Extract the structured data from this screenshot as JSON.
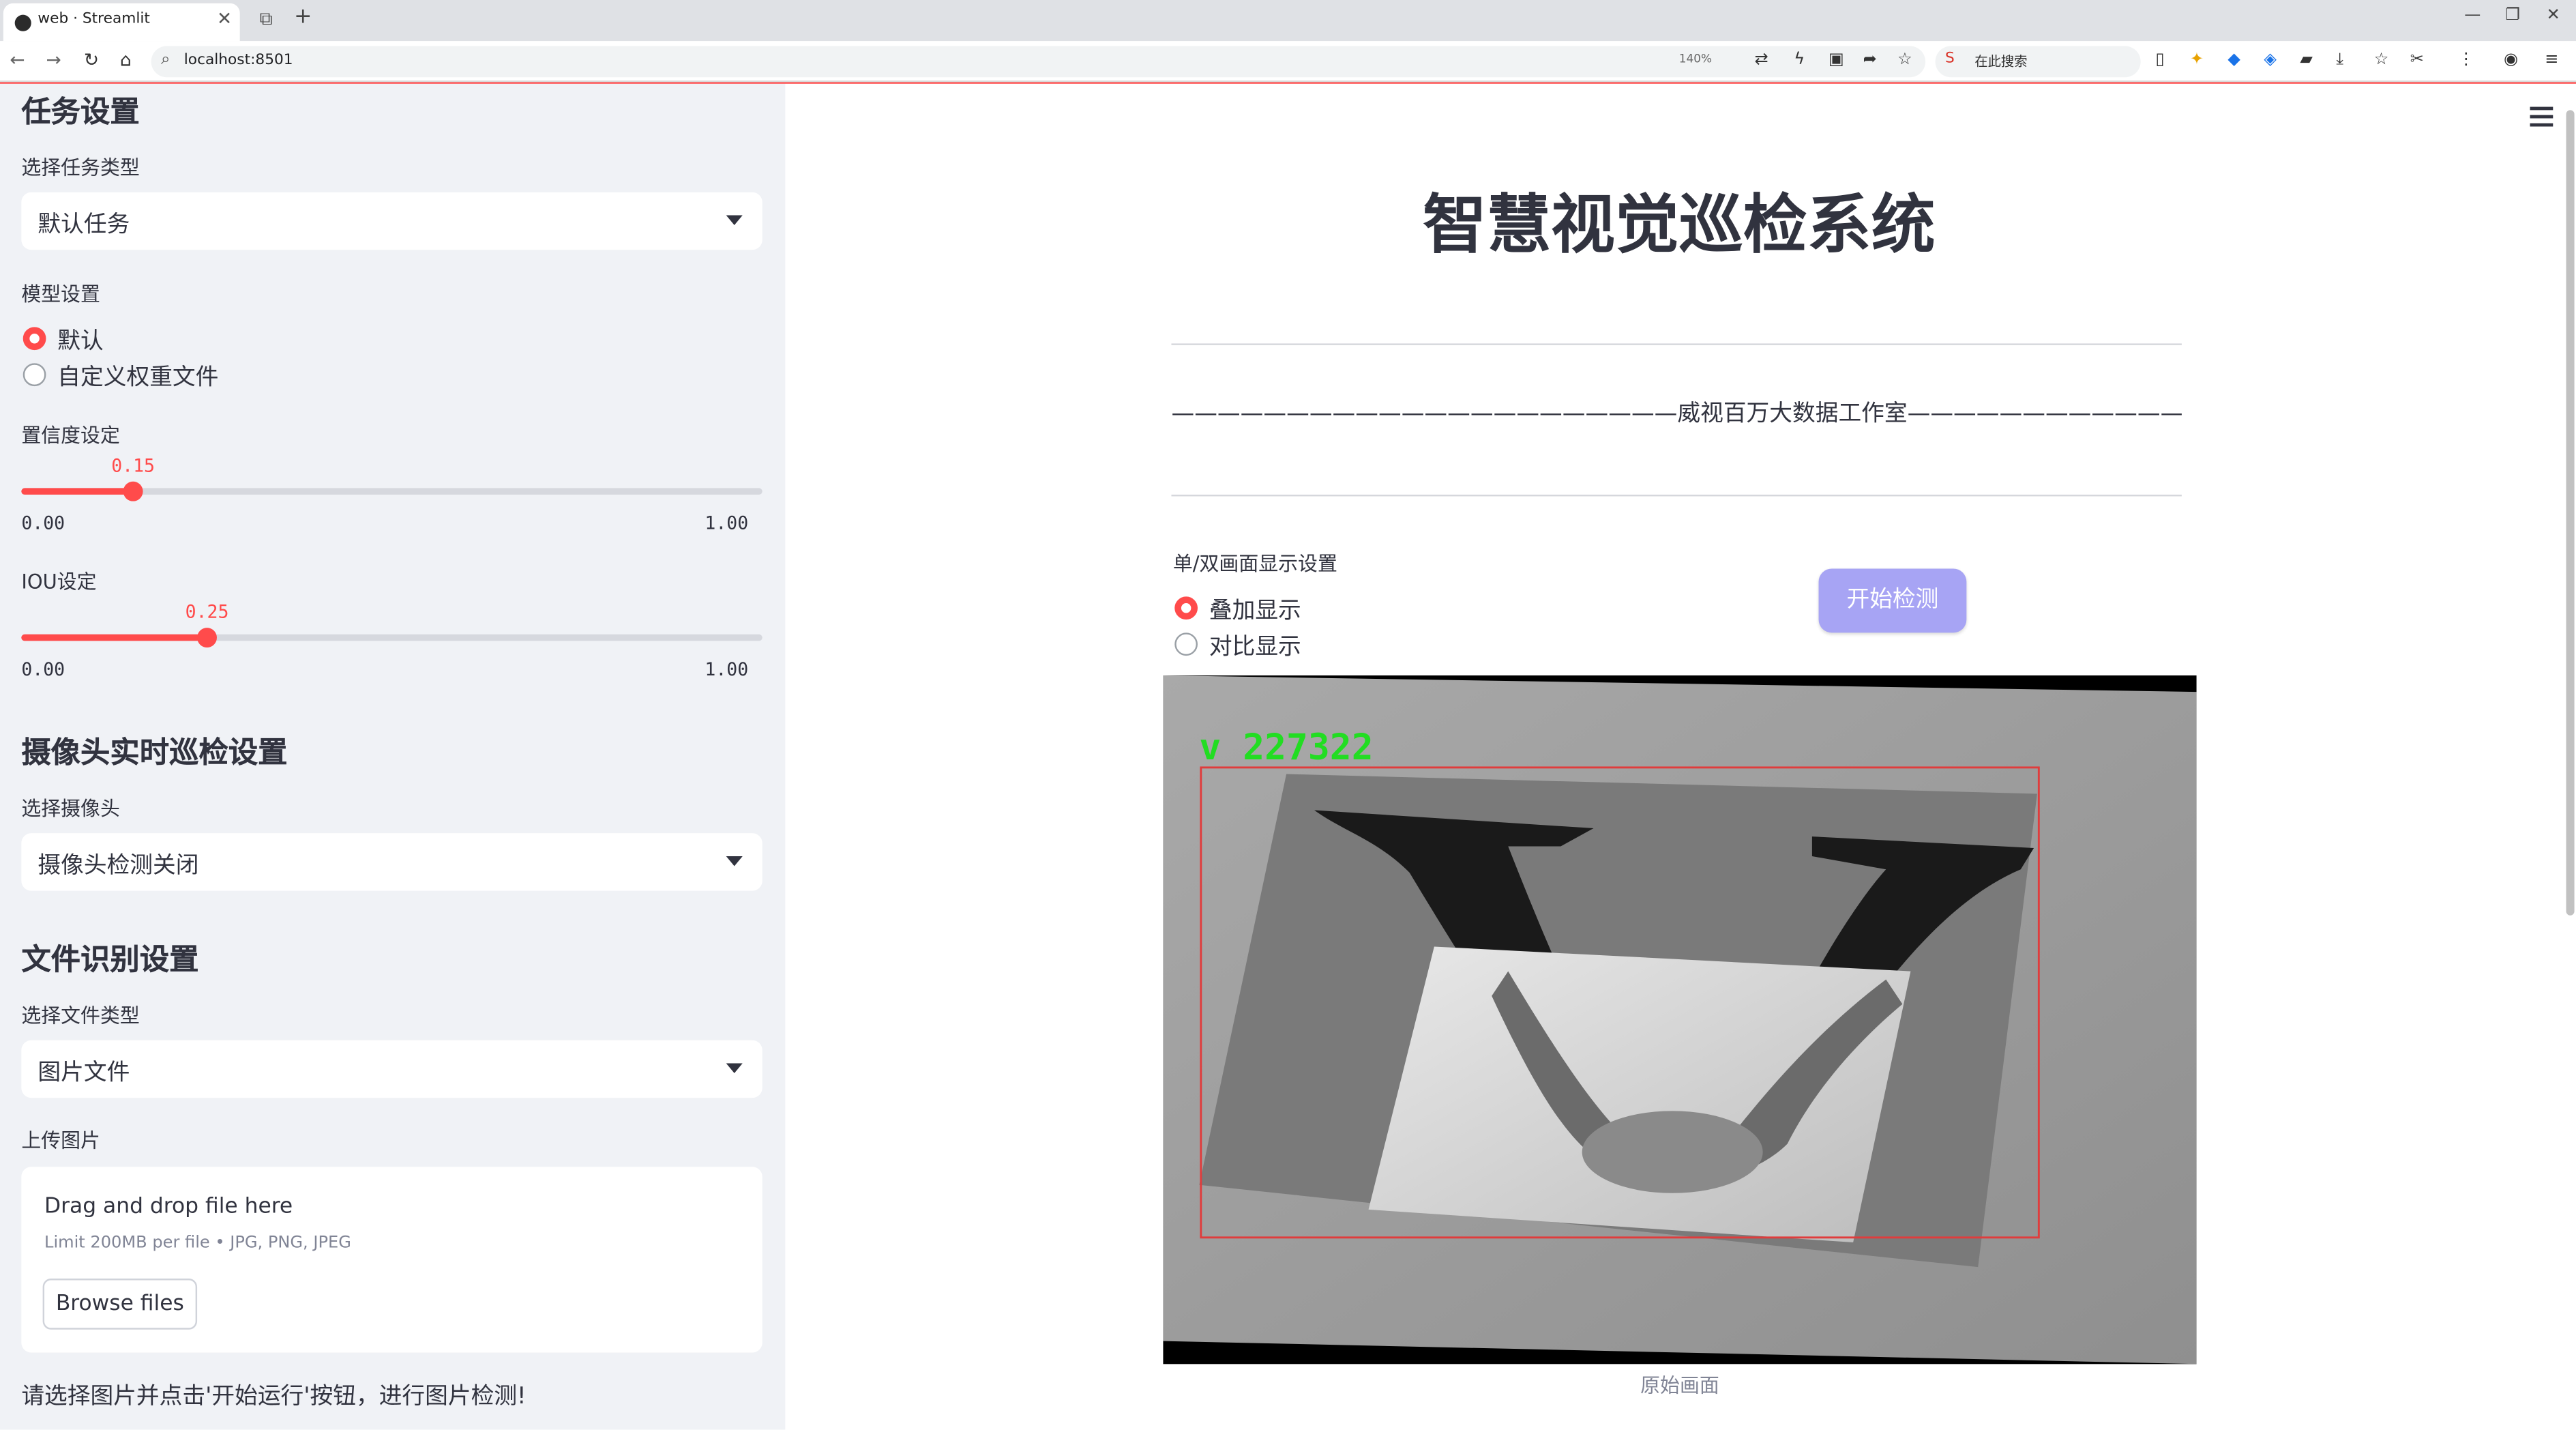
{
  "browser": {
    "tab_title": "web · Streamlit",
    "url": "localhost:8501",
    "zoom": "140%",
    "search_placeholder": "在此搜索"
  },
  "sidebar": {
    "task_heading": "任务设置",
    "task_type_label": "选择任务类型",
    "task_type_value": "默认任务",
    "model_label": "模型设置",
    "model_options": [
      "默认",
      "自定义权重文件"
    ],
    "model_selected": 0,
    "confidence": {
      "label": "置信度设定",
      "value": "0.15",
      "min": "0.00",
      "max": "1.00",
      "fraction": 0.15
    },
    "iou": {
      "label": "IOU设定",
      "value": "0.25",
      "min": "0.00",
      "max": "1.00",
      "fraction": 0.25
    },
    "camera_heading": "摄像头实时巡检设置",
    "camera_label": "选择摄像头",
    "camera_value": "摄像头检测关闭",
    "file_heading": "文件识别设置",
    "file_type_label": "选择文件类型",
    "file_type_value": "图片文件",
    "upload_label": "上传图片",
    "upload_drag": "Drag and drop file here",
    "upload_limit": "Limit 200MB per file • JPG, PNG, JPEG",
    "upload_button": "Browse files",
    "hint": "请选择图片并点击'开始运行'按钮，进行图片检测!"
  },
  "main": {
    "title": "智慧视觉巡检系统",
    "subtitle": "——————————————————————威视百万大数据工作室———————————————————————",
    "display_label": "单/双画面显示设置",
    "display_options": [
      "叠加显示",
      "对比显示"
    ],
    "display_selected": 0,
    "start_button": "开始检测",
    "detection_label": "v 227322",
    "caption": "原始画面"
  },
  "colors": {
    "accent": "#ff4b4b",
    "button": "#a7a4f4",
    "sidebar_bg": "#f0f2f6",
    "detection_box": "#e03c3c",
    "detection_text": "#22dd22"
  }
}
